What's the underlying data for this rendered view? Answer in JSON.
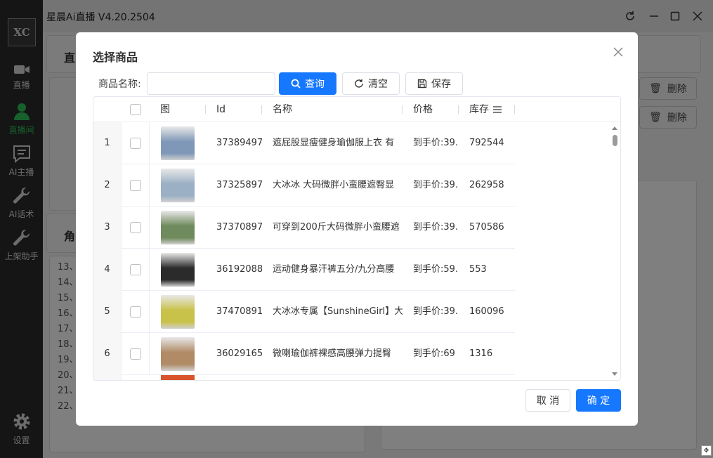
{
  "app": {
    "title": "星晨Ai直播 V4.20.2504",
    "logo_text": "XC"
  },
  "sidebar": {
    "items": [
      {
        "label": "直播",
        "icon": "video-camera-icon"
      },
      {
        "label": "直播间",
        "icon": "user-icon",
        "active": true
      },
      {
        "label": "AI主播",
        "icon": "chat-icon"
      },
      {
        "label": "AI话术",
        "icon": "wrench-icon"
      },
      {
        "label": "上架助手",
        "icon": "wrench-icon"
      },
      {
        "label": "设置",
        "icon": "gear-icon"
      }
    ]
  },
  "background": {
    "panel_title_1": "直",
    "panel_title_2": "角",
    "delete_label": "删除",
    "lines": [
      "13、",
      "14、",
      "15、",
      "16、",
      "17、",
      "18、",
      "19、",
      "20、",
      "21、",
      "22、"
    ]
  },
  "dialog": {
    "title": "选择商品",
    "search_label": "商品名称:",
    "search_value": "",
    "search_placeholder": "",
    "query_label": "查询",
    "clear_label": "清空",
    "save_label": "保存",
    "cancel_label": "取 消",
    "confirm_label": "确 定",
    "columns": {
      "image": "图",
      "id": "Id",
      "name": "名称",
      "price": "价格",
      "stock": "库存"
    },
    "rows": [
      {
        "index": "1",
        "id": "37389497",
        "name": "遮屁股显瘦健身瑜伽服上衣 有",
        "price": "到手价:39.",
        "stock": "792544",
        "thumb": "#7f98b8"
      },
      {
        "index": "2",
        "id": "37325897",
        "name": "大冰冰 大码微胖小蛮腰遮臀显",
        "price": "到手价:39.",
        "stock": "262958",
        "thumb": "#9bb0c4"
      },
      {
        "index": "3",
        "id": "37370897",
        "name": "可穿到200斤大码微胖小蛮腰遮",
        "price": "到手价:39.",
        "stock": "570586",
        "thumb": "#6f8a5c"
      },
      {
        "index": "4",
        "id": "36192088",
        "name": "运动健身暴汗裤五分/九分高腰",
        "price": "到手价:59.",
        "stock": "553",
        "thumb": "#2b2b2b"
      },
      {
        "index": "5",
        "id": "37470891",
        "name": "大冰冰专属【SunshineGirl】大",
        "price": "到手价:39.",
        "stock": "160096",
        "thumb": "#c9c24a"
      },
      {
        "index": "6",
        "id": "36029165",
        "name": "微喇瑜伽裤裸感高腰弹力提臀",
        "price": "到手价:69",
        "stock": "1316",
        "thumb": "#b08b66"
      }
    ]
  }
}
